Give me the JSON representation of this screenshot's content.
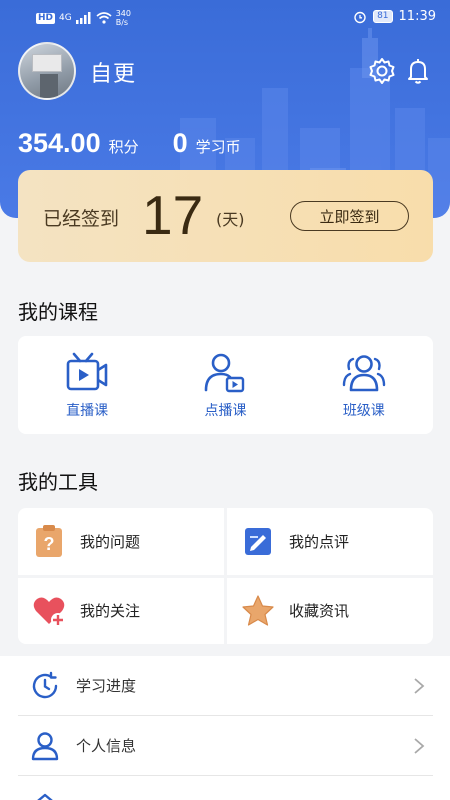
{
  "status_bar": {
    "hd_label": "HD",
    "network_label": "4G",
    "speed_value": "340",
    "speed_unit": "B/s",
    "battery": "81",
    "time": "11:39"
  },
  "profile": {
    "username": "自更"
  },
  "stats": {
    "points_value": "354.00",
    "points_unit": "积分",
    "coins_value": "0",
    "coins_unit": "学习币"
  },
  "checkin": {
    "label": "已经签到",
    "days": "17",
    "days_unit": "(天)",
    "button_label": "立即签到"
  },
  "courses": {
    "title": "我的课程",
    "items": [
      {
        "label": "直播课",
        "icon": "live-tv-icon"
      },
      {
        "label": "点播课",
        "icon": "user-video-icon"
      },
      {
        "label": "班级课",
        "icon": "group-icon"
      }
    ]
  },
  "tools": {
    "title": "我的工具",
    "items": [
      {
        "label": "我的问题",
        "icon": "question-clipboard-icon"
      },
      {
        "label": "我的点评",
        "icon": "edit-note-icon"
      },
      {
        "label": "我的关注",
        "icon": "heart-plus-icon"
      },
      {
        "label": "收藏资讯",
        "icon": "star-icon"
      }
    ]
  },
  "menu": {
    "items": [
      {
        "label": "学习进度",
        "icon": "clock-icon"
      },
      {
        "label": "个人信息",
        "icon": "person-icon"
      }
    ]
  },
  "colors": {
    "header_blue": "#3a6cd8",
    "accent_blue": "#2a5fc7",
    "checkin_gold": "#f8ddab",
    "tool_orange": "#e9a66b",
    "tool_red": "#e8515d"
  }
}
